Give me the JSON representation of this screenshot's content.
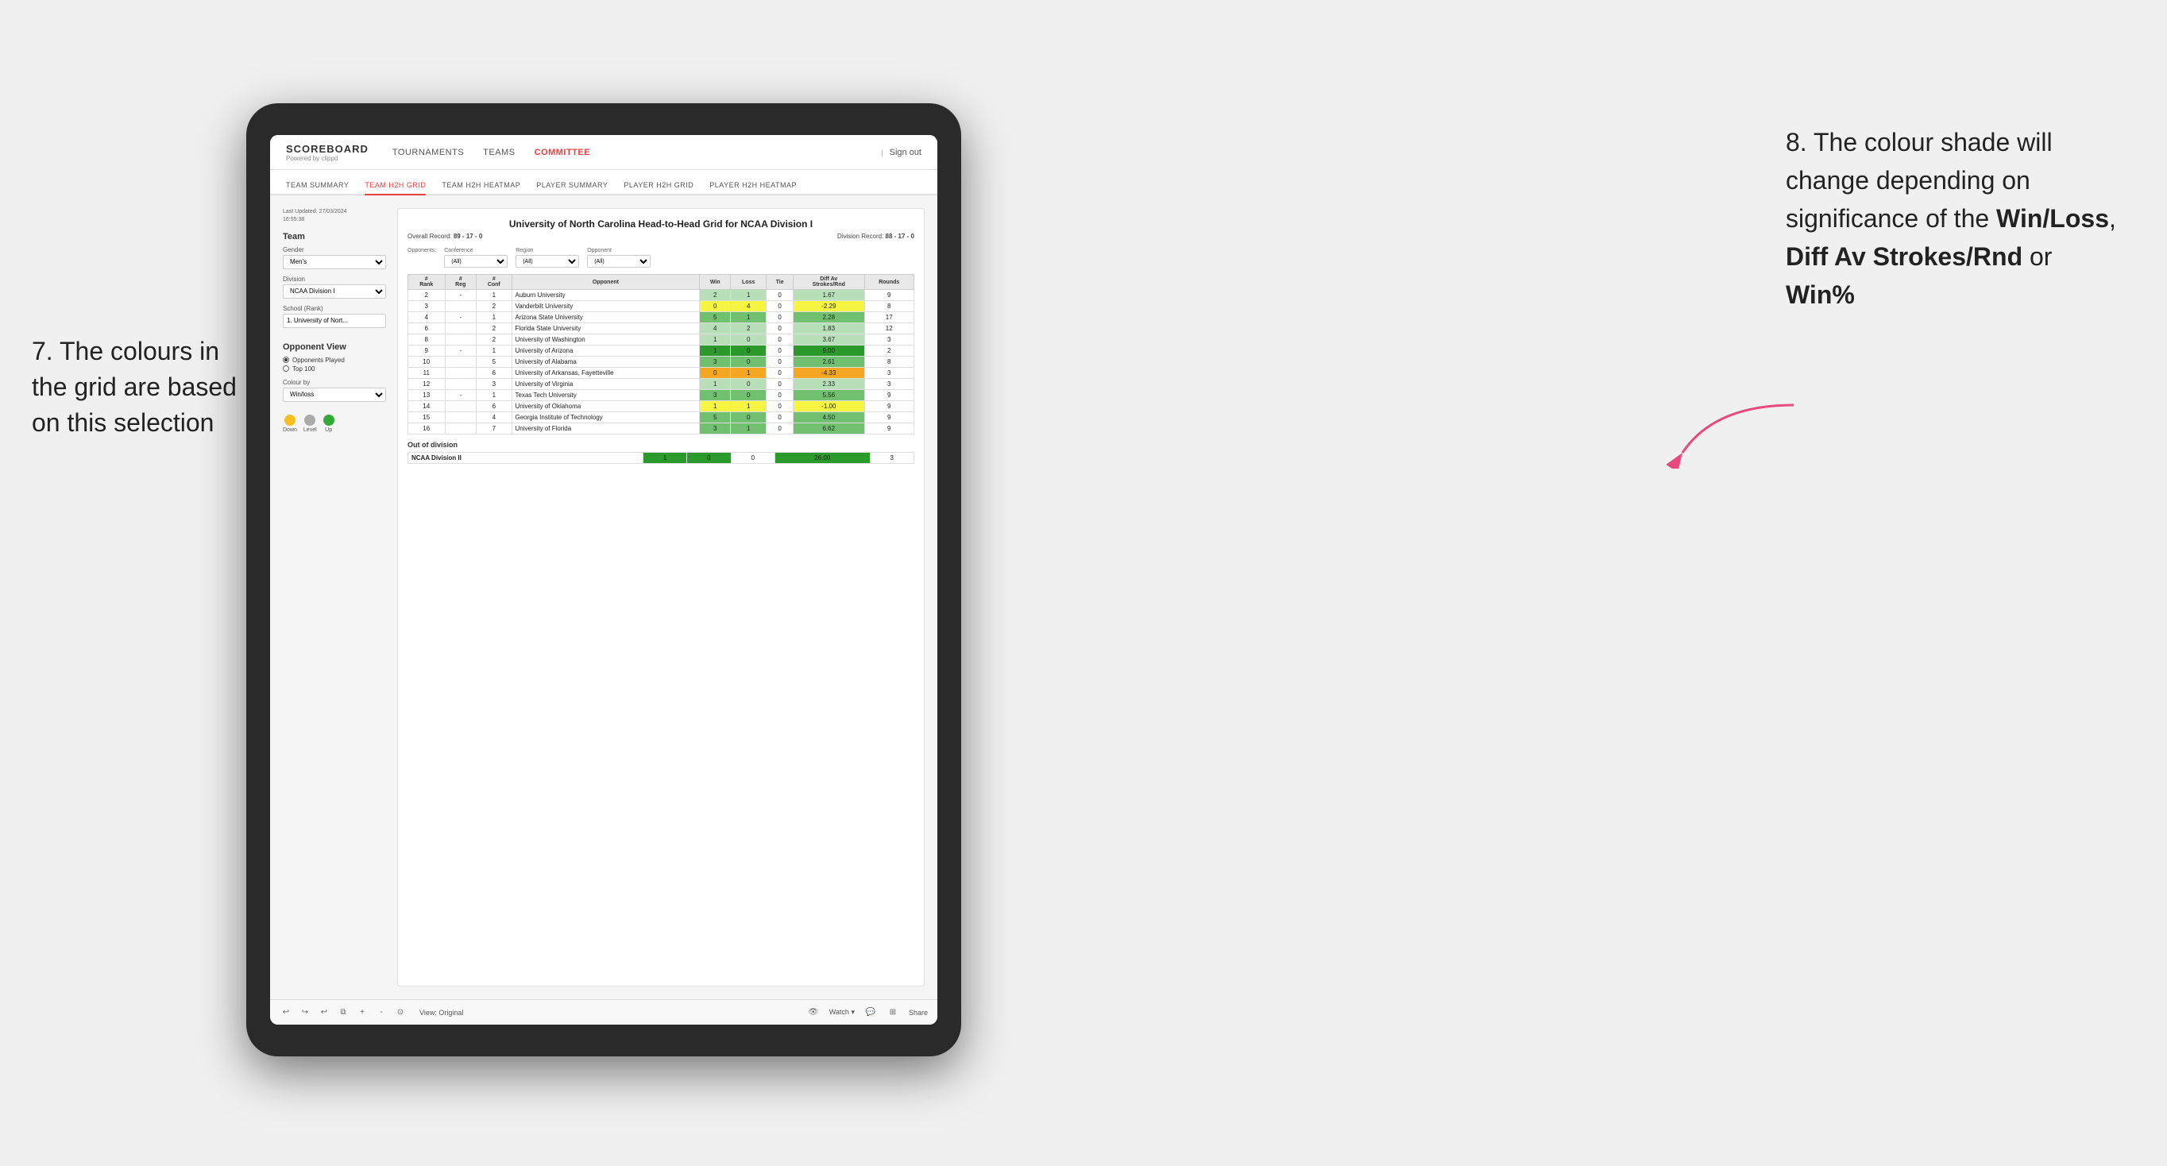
{
  "annotations": {
    "left_number": "7.",
    "left_text": "The colours in the grid are based on this selection",
    "right_number": "8.",
    "right_text_1": "The colour shade will change depending on significance of the ",
    "right_bold_1": "Win/Loss",
    "right_text_2": ", ",
    "right_bold_2": "Diff Av Strokes/Rnd",
    "right_text_3": " or ",
    "right_bold_3": "Win%"
  },
  "navbar": {
    "logo": "SCOREBOARD",
    "logo_sub": "Powered by clippd",
    "nav_items": [
      "TOURNAMENTS",
      "TEAMS",
      "COMMITTEE"
    ],
    "active_nav": "COMMITTEE",
    "signin": "Sign out"
  },
  "subnav": {
    "items": [
      "TEAM SUMMARY",
      "TEAM H2H GRID",
      "TEAM H2H HEATMAP",
      "PLAYER SUMMARY",
      "PLAYER H2H GRID",
      "PLAYER H2H HEATMAP"
    ],
    "active": "TEAM H2H GRID"
  },
  "left_panel": {
    "last_updated_label": "Last Updated: 27/03/2024",
    "last_updated_time": "16:55:38",
    "team_label": "Team",
    "gender_label": "Gender",
    "gender_value": "Men's",
    "division_label": "Division",
    "division_value": "NCAA Division I",
    "school_label": "School (Rank)",
    "school_value": "1. University of Nort...",
    "opponent_view_label": "Opponent View",
    "radio_1": "Opponents Played",
    "radio_2": "Top 100",
    "colour_by_label": "Colour by",
    "colour_by_value": "Win/loss",
    "legend_down": "Down",
    "legend_level": "Level",
    "legend_up": "Up"
  },
  "grid": {
    "title": "University of North Carolina Head-to-Head Grid for NCAA Division I",
    "overall_record_label": "Overall Record:",
    "overall_record": "89 - 17 - 0",
    "division_record_label": "Division Record:",
    "division_record": "88 - 17 - 0",
    "filter_opponents_label": "Opponents:",
    "filter_conference_label": "Conference",
    "filter_region_label": "Region",
    "filter_opponent_label": "Opponent",
    "filter_all": "(All)",
    "table_headers": [
      "#\nRank",
      "#\nReg",
      "#\nConf",
      "Opponent",
      "Win",
      "Loss",
      "Tie",
      "Diff Av\nStrokes/Rnd",
      "Rounds"
    ],
    "rows": [
      {
        "rank": "2",
        "reg": "-",
        "conf": "1",
        "opponent": "Auburn University",
        "win": "2",
        "loss": "1",
        "tie": "0",
        "diff": "1.67",
        "rounds": "9",
        "color": "green_light"
      },
      {
        "rank": "3",
        "reg": "",
        "conf": "2",
        "opponent": "Vanderbilt University",
        "win": "0",
        "loss": "4",
        "tie": "0",
        "diff": "-2.29",
        "rounds": "8",
        "color": "yellow"
      },
      {
        "rank": "4",
        "reg": "-",
        "conf": "1",
        "opponent": "Arizona State University",
        "win": "5",
        "loss": "1",
        "tie": "0",
        "diff": "2.28",
        "rounds": "17",
        "color": "green_med"
      },
      {
        "rank": "6",
        "reg": "",
        "conf": "2",
        "opponent": "Florida State University",
        "win": "4",
        "loss": "2",
        "tie": "0",
        "diff": "1.83",
        "rounds": "12",
        "color": "green_light"
      },
      {
        "rank": "8",
        "reg": "",
        "conf": "2",
        "opponent": "University of Washington",
        "win": "1",
        "loss": "0",
        "tie": "0",
        "diff": "3.67",
        "rounds": "3",
        "color": "green_light"
      },
      {
        "rank": "9",
        "reg": "-",
        "conf": "1",
        "opponent": "University of Arizona",
        "win": "1",
        "loss": "0",
        "tie": "0",
        "diff": "9.00",
        "rounds": "2",
        "color": "green_dark"
      },
      {
        "rank": "10",
        "reg": "",
        "conf": "5",
        "opponent": "University of Alabama",
        "win": "3",
        "loss": "0",
        "tie": "0",
        "diff": "2.61",
        "rounds": "8",
        "color": "green_med"
      },
      {
        "rank": "11",
        "reg": "",
        "conf": "6",
        "opponent": "University of Arkansas, Fayetteville",
        "win": "0",
        "loss": "1",
        "tie": "0",
        "diff": "-4.33",
        "rounds": "3",
        "color": "orange"
      },
      {
        "rank": "12",
        "reg": "",
        "conf": "3",
        "opponent": "University of Virginia",
        "win": "1",
        "loss": "0",
        "tie": "0",
        "diff": "2.33",
        "rounds": "3",
        "color": "green_light"
      },
      {
        "rank": "13",
        "reg": "-",
        "conf": "1",
        "opponent": "Texas Tech University",
        "win": "3",
        "loss": "0",
        "tie": "0",
        "diff": "5.56",
        "rounds": "9",
        "color": "green_med"
      },
      {
        "rank": "14",
        "reg": "",
        "conf": "6",
        "opponent": "University of Oklahoma",
        "win": "1",
        "loss": "1",
        "tie": "0",
        "diff": "-1.00",
        "rounds": "9",
        "color": "yellow"
      },
      {
        "rank": "15",
        "reg": "",
        "conf": "4",
        "opponent": "Georgia Institute of Technology",
        "win": "5",
        "loss": "0",
        "tie": "0",
        "diff": "4.50",
        "rounds": "9",
        "color": "green_med"
      },
      {
        "rank": "16",
        "reg": "",
        "conf": "7",
        "opponent": "University of Florida",
        "win": "3",
        "loss": "1",
        "tie": "0",
        "diff": "6.62",
        "rounds": "9",
        "color": "green_med"
      }
    ],
    "out_of_division_label": "Out of division",
    "out_of_division_rows": [
      {
        "division": "NCAA Division II",
        "win": "1",
        "loss": "0",
        "tie": "0",
        "diff": "26.00",
        "rounds": "3",
        "color": "green_dark"
      }
    ]
  },
  "toolbar": {
    "view_label": "View: Original",
    "watch_label": "Watch ▾",
    "share_label": "Share"
  }
}
